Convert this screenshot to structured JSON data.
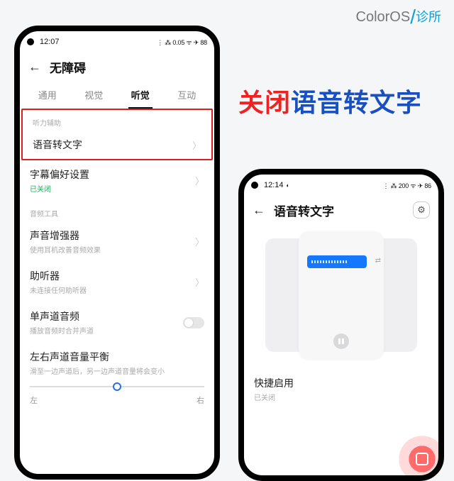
{
  "brand": {
    "name": "ColorOS",
    "sub": "诊所"
  },
  "headline": {
    "red": "关闭",
    "blue": "语音转文字"
  },
  "phone1": {
    "status": {
      "time": "12:07",
      "right": "⋮ ⁂ 0.05 ᯤ ✈ 88"
    },
    "nav": {
      "title": "无障碍"
    },
    "tabs": [
      "通用",
      "视觉",
      "听觉",
      "互动"
    ],
    "active_tab": 2,
    "sections": {
      "hearing_aid": {
        "label": "听力辅助"
      },
      "audio_tools": {
        "label": "音频工具"
      }
    },
    "rows": {
      "stt": {
        "title": "语音转文字"
      },
      "caption": {
        "title": "字幕偏好设置",
        "sub": "已关闭"
      },
      "enhancer": {
        "title": "声音增强器",
        "sub": "使用耳机改善音频效果"
      },
      "hearing": {
        "title": "助听器",
        "sub": "未连接任何助听器"
      },
      "mono": {
        "title": "单声道音频",
        "sub": "播放音频时合并声道"
      },
      "balance": {
        "title": "左右声道音量平衡",
        "sub": "滑至一边声道后，另一边声道音量将会变小"
      }
    },
    "slider": {
      "left": "左",
      "right": "右"
    }
  },
  "phone2": {
    "status": {
      "time": "12:14",
      "right": "⋮ ⁂ 200 ᯤ ✈ 86"
    },
    "nav": {
      "title": "语音转文字"
    },
    "quick": {
      "title": "快捷启用",
      "sub": "已关闭"
    }
  }
}
